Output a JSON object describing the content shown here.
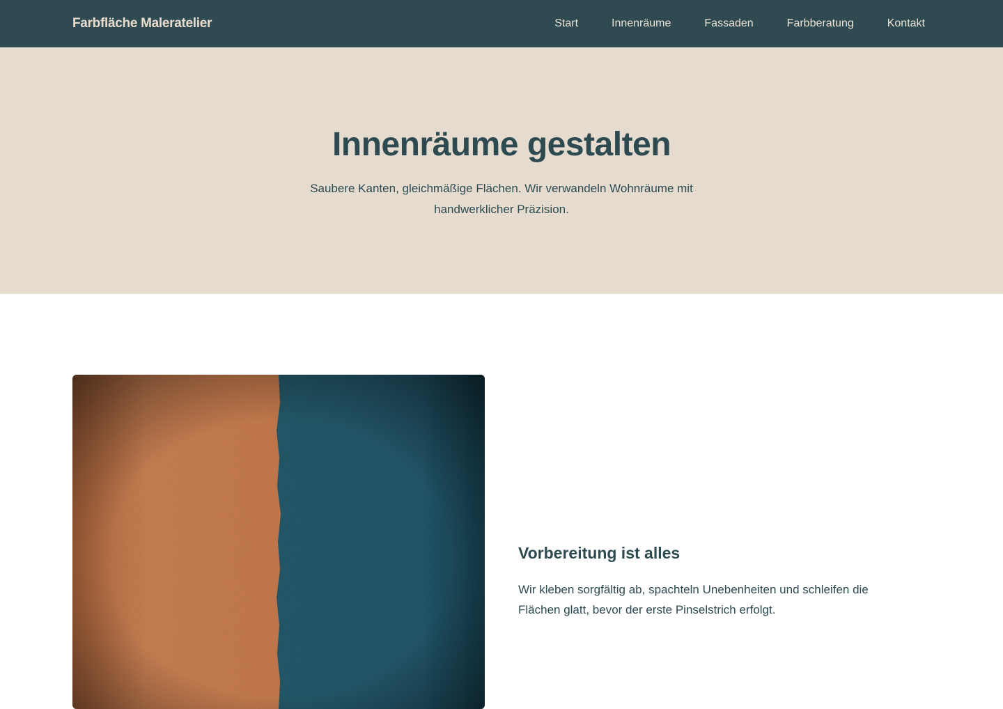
{
  "header": {
    "brand": "Farbfläche Maleratelier",
    "nav": [
      {
        "label": "Start"
      },
      {
        "label": "Innenräume"
      },
      {
        "label": "Fassaden"
      },
      {
        "label": "Farbberatung"
      },
      {
        "label": "Kontakt"
      }
    ]
  },
  "hero": {
    "title": "Innenräume gestalten",
    "subtitle": "Saubere Kanten, gleichmäßige Flächen. Wir verwandeln Wohnräume mit handwerklicher Präzision."
  },
  "feature": {
    "image_icon": "painted-wall-photo",
    "heading": "Vorbereitung ist alles",
    "body": "Wir kleben sorgfältig ab, spachteln Unebenheiten und schleifen die Flächen glatt, bevor der erste Pinselstrich erfolgt."
  },
  "colors": {
    "header_bg": "#2f4b51",
    "hero_bg": "#e6dbcf",
    "text": "#2c4a50",
    "paint_orange": "#c97d4f",
    "paint_teal": "#22596a"
  }
}
